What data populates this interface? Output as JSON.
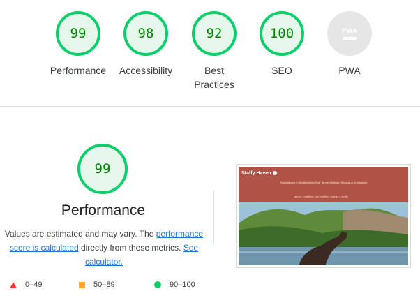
{
  "categories": [
    {
      "label": "Performance",
      "score": "99"
    },
    {
      "label": "Accessibility",
      "score": "98"
    },
    {
      "label": "Best\nPractices",
      "score": "92"
    },
    {
      "label": "SEO",
      "score": "100"
    },
    {
      "label": "PWA",
      "score": null,
      "badge_text": "PWA"
    }
  ],
  "performance": {
    "score": "99",
    "title": "Performance",
    "desc_part1": "Values are estimated and may vary. The ",
    "desc_link1": "performance score is calculated",
    "desc_part2": " directly from these metrics. ",
    "desc_link2": "See calculator."
  },
  "legend": [
    {
      "shape": "triangle",
      "color": "#ff3333",
      "range": "0–49"
    },
    {
      "shape": "square",
      "color": "#ffaa33",
      "range": "50–89"
    },
    {
      "shape": "circle",
      "color": "#0cce6b",
      "range": "90–100"
    }
  ],
  "screenshot": {
    "site_name": "Staffy Haven",
    "tagline": "Specialising in Staffordshire Bull Terrier Welfare, Rescue and Adoption",
    "nav": "about • staffies • our staffies • adopt a staffy"
  },
  "colors": {
    "pass": "#0cce6b",
    "pass_text": "#008800",
    "pass_fill": "#e6f8ec",
    "link": "#1a73e8"
  }
}
